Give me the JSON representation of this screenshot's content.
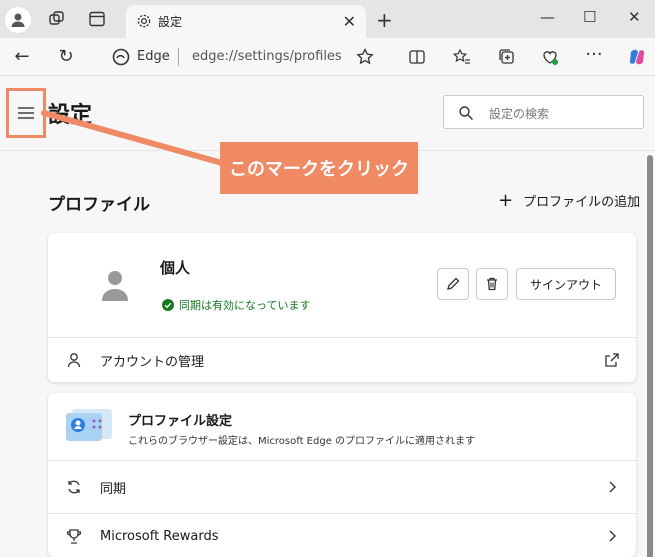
{
  "tab": {
    "title": "設定"
  },
  "toolbar": {
    "edge_label": "Edge",
    "url": "edge://settings/profiles"
  },
  "header": {
    "title": "設定",
    "search_placeholder": "設定の検索"
  },
  "callout": {
    "text": "このマークをクリック"
  },
  "section": {
    "title": "プロファイル",
    "add_label": "プロファイルの追加"
  },
  "profile": {
    "name": "個人",
    "sync_status": "同期は有効になっています",
    "signout_label": "サインアウト",
    "manage_label": "アカウントの管理"
  },
  "profile_settings": {
    "title": "プロファイル設定",
    "description": "これらのブラウザー設定は、Microsoft Edge のプロファイルに適用されます"
  },
  "rows": {
    "sync": "同期",
    "rewards": "Microsoft Rewards"
  },
  "colors": {
    "accent": "#f08a65",
    "sync_green": "#137a1f"
  }
}
